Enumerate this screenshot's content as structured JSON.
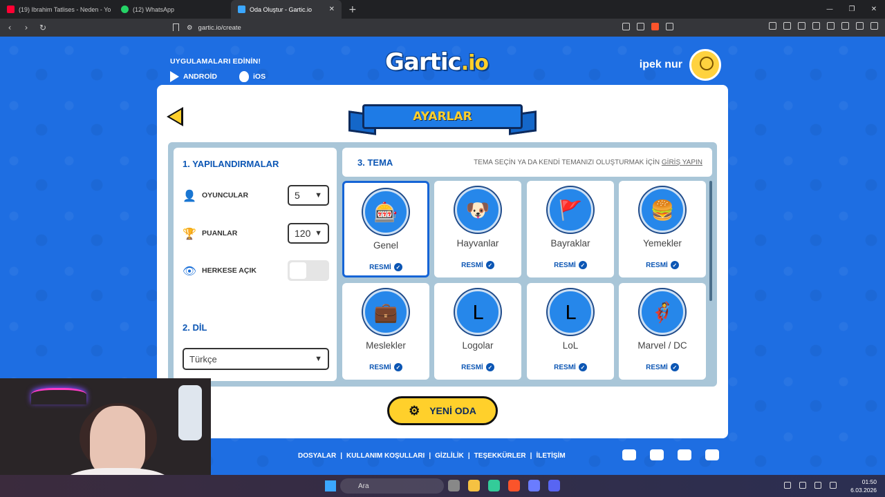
{
  "browser": {
    "tabs": [
      {
        "title": "(19) Ibrahim Tatlises - Neden - Yo",
        "color": "#ff0033"
      },
      {
        "title": "(12) WhatsApp",
        "color": "#25d366"
      },
      {
        "title": "Oda Oluştur - Gartic.io",
        "color": "#3ba7ff",
        "active": true
      }
    ],
    "url": "gartic.io/create"
  },
  "apps": {
    "title": "UYGULAMALARI EDİNİN!",
    "android": "ANDROİD",
    "ios": "iOS"
  },
  "logo": {
    "main": "Gartic",
    "suffix": ".io"
  },
  "user": {
    "name": "ipek nur"
  },
  "settings": {
    "title": "AYARLAR",
    "config_heading": "1. YAPILANDIRMALAR",
    "players_label": "OYUNCULAR",
    "players_value": "5",
    "points_label": "PUANLAR",
    "points_value": "120",
    "public_label": "HERKESE AÇIK",
    "public_on": false,
    "language_heading": "2. DİL",
    "language_value": "Türkçe",
    "theme_heading": "3. TEMA",
    "theme_hint": "TEMA SEÇİN YA DA KENDİ TEMANIZI OLUŞTURMAK İÇİN",
    "theme_hint_link": "GİRİŞ YAPIN",
    "themes": [
      {
        "name": "Genel",
        "tag": "RESMİ",
        "emoji": "🎰",
        "selected": true
      },
      {
        "name": "Hayvanlar",
        "tag": "RESMİ",
        "emoji": "🐶"
      },
      {
        "name": "Bayraklar",
        "tag": "RESMİ",
        "emoji": "🚩"
      },
      {
        "name": "Yemekler",
        "tag": "RESMİ",
        "emoji": "🍔"
      },
      {
        "name": "Meslekler",
        "tag": "RESMİ",
        "emoji": "💼"
      },
      {
        "name": "Logolar",
        "tag": "RESMİ",
        "emoji": "L"
      },
      {
        "name": "LoL",
        "tag": "RESMİ",
        "emoji": "L"
      },
      {
        "name": "Marvel / DC",
        "tag": "RESMİ",
        "emoji": "🦸"
      }
    ],
    "create_button": "YENİ ODA"
  },
  "footer": {
    "links": [
      "DOSYALAR",
      "|",
      "KULLANIM KOŞULLARI",
      "|",
      "GİZLİLİK",
      "|",
      "TEŞEKKÜRLER",
      "|",
      "İLETİŞİM"
    ],
    "social": [
      "twitter-icon",
      "youtube-icon",
      "instagram-icon",
      "discord-icon"
    ]
  },
  "taskbar": {
    "search": "Ara",
    "time": "01:50",
    "date": "6.03.2026"
  }
}
